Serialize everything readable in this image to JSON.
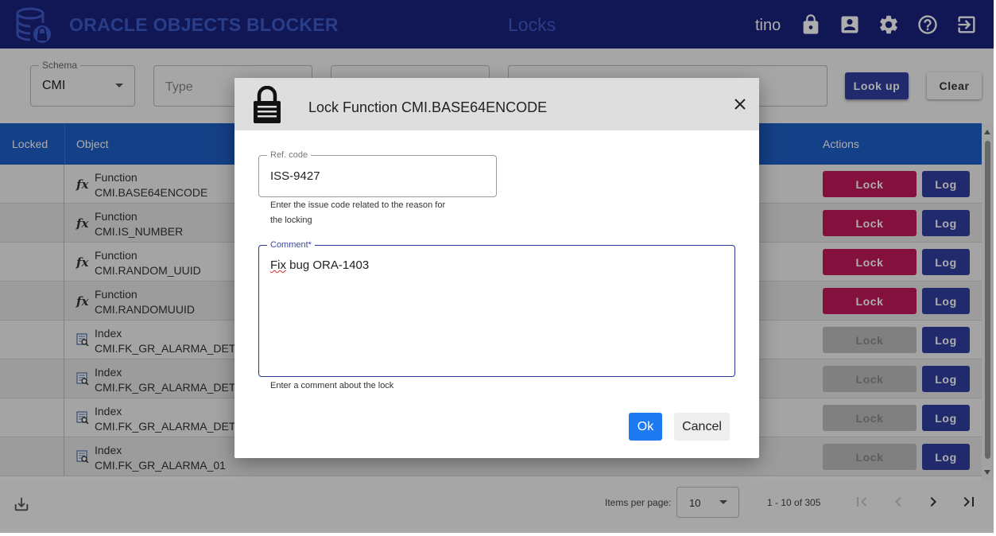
{
  "header": {
    "app_title": "ORACLE OBJECTS BLOCKER",
    "page_title": "Locks",
    "username": "tino",
    "icons": [
      "lock-icon",
      "account-box-icon",
      "gear-icon",
      "help-icon",
      "logout-icon"
    ]
  },
  "filters": {
    "schema_label": "Schema",
    "schema_value": "CMI",
    "type_placeholder": "Type",
    "lookup_label": "Look up",
    "clear_label": "Clear"
  },
  "table": {
    "columns": {
      "locked": "Locked",
      "object": "Object",
      "actions": "Actions"
    },
    "lock_label": "Lock",
    "log_label": "Log",
    "rows": [
      {
        "type": "Function",
        "name": "CMI.BASE64ENCODE",
        "icon": "function-icon",
        "lock_enabled": true
      },
      {
        "type": "Function",
        "name": "CMI.IS_NUMBER",
        "icon": "function-icon",
        "lock_enabled": true
      },
      {
        "type": "Function",
        "name": "CMI.RANDOM_UUID",
        "icon": "function-icon",
        "lock_enabled": true
      },
      {
        "type": "Function",
        "name": "CMI.RANDOMUUID",
        "icon": "function-icon",
        "lock_enabled": true
      },
      {
        "type": "Index",
        "name": "CMI.FK_GR_ALARMA_DETALL",
        "icon": "index-icon",
        "lock_enabled": false
      },
      {
        "type": "Index",
        "name": "CMI.FK_GR_ALARMA_DETALL",
        "icon": "index-icon",
        "lock_enabled": false
      },
      {
        "type": "Index",
        "name": "CMI.FK_GR_ALARMA_DETALL",
        "icon": "index-icon",
        "lock_enabled": false
      },
      {
        "type": "Index",
        "name": "CMI.FK_GR_ALARMA_01",
        "icon": "index-icon",
        "lock_enabled": false
      }
    ]
  },
  "paginator": {
    "items_per_page_label": "Items per page:",
    "items_per_page_value": "10",
    "range": "1 - 10 of 305"
  },
  "dialog": {
    "title": "Lock Function CMI.BASE64ENCODE",
    "ref_label": "Ref. code",
    "ref_value": "ISS-9427",
    "ref_hint_line1": "Enter the issue code related to the reason for",
    "ref_hint_line2": "the locking",
    "comment_label": "Comment*",
    "comment_word1": "Fix",
    "comment_rest": " bug ORA-1403",
    "comment_hint": "Enter a comment about the lock",
    "ok_label": "Ok",
    "cancel_label": "Cancel"
  },
  "colors": {
    "header_bg": "#1a237e",
    "title_blue": "#3e5bc9",
    "table_header": "#1e5fc7",
    "lock_active": "#c2185b",
    "log_button": "#303f9f",
    "ok_button": "#1e7af0"
  }
}
